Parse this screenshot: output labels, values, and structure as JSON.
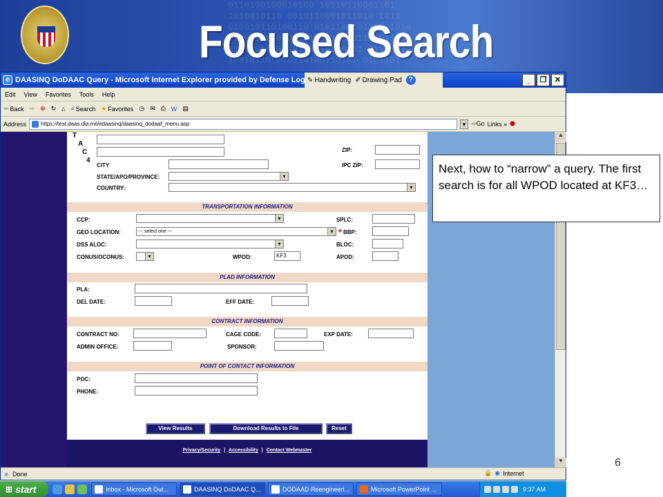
{
  "slide": {
    "title": "Focused Search",
    "number": "6",
    "binary_texture": "0110100100010100 10110110001101\n1010010110 0010110001011010 1011\n010010110100110 0101100101100 1010\n11001010 01011010011 0101101010 01\n0101101100 10100110100101 0110101\n10010110 010110100110101 0101101"
  },
  "browser": {
    "title": "DAASINQ DoDAAC Query - Microsoft Internet Explorer provided by Defense Logistics A",
    "ink_tools": [
      "Handwriting",
      "Drawing Pad"
    ],
    "window_buttons": [
      "_",
      "❐",
      "✕"
    ],
    "menu": [
      "Edit",
      "View",
      "Favorites",
      "Tools",
      "Help"
    ],
    "toolbar": [
      "Back",
      "Search",
      "Favorites"
    ],
    "address_label": "Address",
    "address_url": "https://test.daas.dla.mil/edaasinq/daasinq_dodaaf_menu.asp",
    "go_label": "Go",
    "links_label": "Links",
    "status_text": "Done",
    "zone_text": "Internet"
  },
  "form": {
    "side_letters": [
      "T",
      "A",
      "C",
      "4"
    ],
    "labels": {
      "city": "CITY",
      "state": "STATE/APO/PROVINCE:",
      "country": "COUNTRY:",
      "zip": "ZIP:",
      "ipc_zip": "IPC ZIP:",
      "ccp": "CCP:",
      "geo": "GEO LOCATION:",
      "dss": "DSS ALOC:",
      "conus": "CONUS/OCONUS:",
      "wpod": "WPOD:",
      "splc": "SPLC:",
      "bbp": "BBP:",
      "bloc": "BLOC:",
      "apod": "APOD:",
      "pla": "PLA:",
      "del_date": "DEL DATE:",
      "eff_date": "EFF DATE:",
      "contract_no": "CONTRACT NO:",
      "cage": "CAGE CODE:",
      "exp_date": "EXP DATE:",
      "admin": "ADMIN OFFICE:",
      "sponsor": "SPONSOR:",
      "poc": "POC:",
      "phone": "PHONE:"
    },
    "sections": {
      "transport": "TRANSPORTATION INFORMATION",
      "plad": "PLAD INFORMATION",
      "contract": "CONTRACT INFORMATION",
      "poc": "POINT OF CONTACT INFORMATION"
    },
    "geo_select_value": "--- select one ---",
    "bbp_marker": "+",
    "wpod_value": "KF3",
    "buttons": {
      "view": "View Results",
      "download": "Download Results to File",
      "reset": "Reset"
    },
    "footer_links": [
      "Privacy/Security",
      "Accessibility",
      "Contact Webmaster"
    ],
    "footer_sep": "|"
  },
  "taskbar": {
    "start": "start",
    "tasks": [
      "Inbox - Microsoft Out...",
      "DAASINQ DoDAAC Q...",
      "DODAAD Reengineeri...",
      "Microsoft PowerPoint ..."
    ],
    "clock": "9:37 AM"
  },
  "callout": {
    "text": "Next, how to “narrow” a query.  The first search is for all WPOD located at KF3…"
  }
}
